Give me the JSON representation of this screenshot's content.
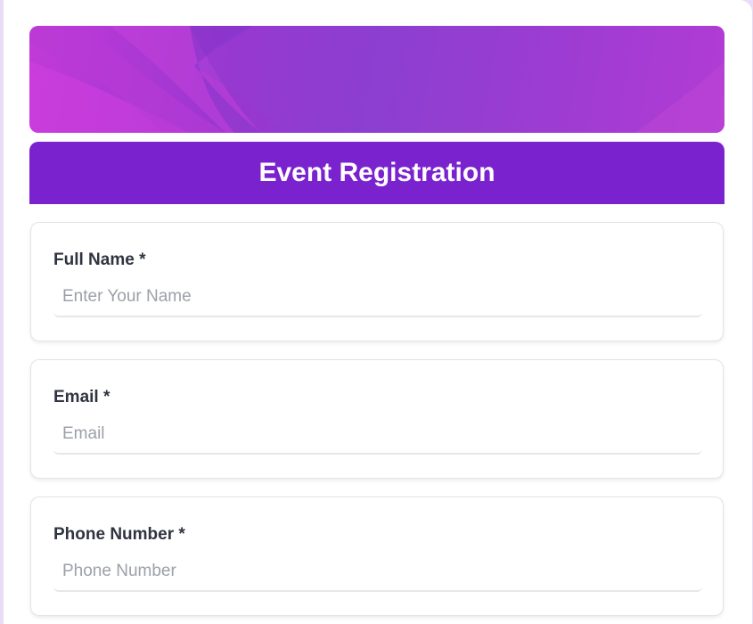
{
  "form": {
    "title": "Event Registration",
    "fields": [
      {
        "label": "Full Name *",
        "placeholder": "Enter Your Name",
        "value": ""
      },
      {
        "label": "Email *",
        "placeholder": "Email",
        "value": ""
      },
      {
        "label": "Phone Number *",
        "placeholder": "Phone Number",
        "value": ""
      }
    ]
  },
  "colors": {
    "header": "#7b22cf",
    "banner_start": "#c23ad8",
    "banner_mid": "#8a3fd0",
    "background": "#e9dcf7"
  }
}
